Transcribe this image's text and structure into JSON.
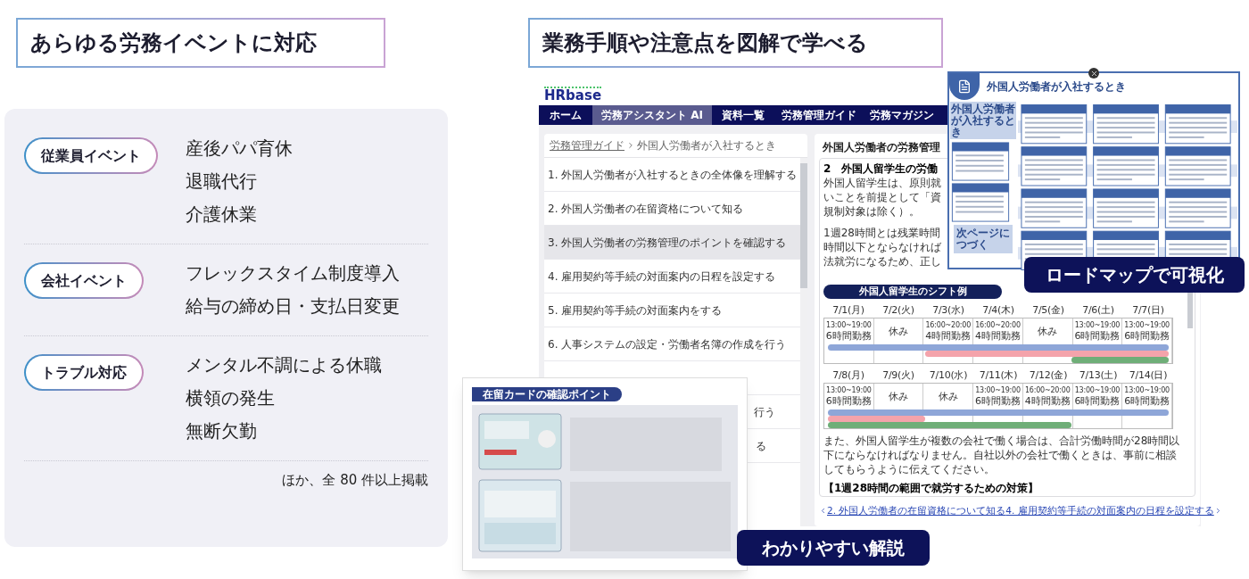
{
  "left_heading": "あらゆる労務イベントに対応",
  "event_groups": [
    {
      "label": "従業員イベント",
      "items": [
        "産後パパ育休",
        "退職代行",
        "介護休業"
      ]
    },
    {
      "label": "会社イベント",
      "items": [
        "フレックスタイム制度導入",
        "給与の締め日・支払日変更"
      ]
    },
    {
      "label": "トラブル対応",
      "items": [
        "メンタル不調による休職",
        "横領の発生",
        "無断欠勤"
      ]
    }
  ],
  "event_note": "ほか、全 80 件以上掲載",
  "right_heading": "業務手順や注意点を図解で学べる",
  "app": {
    "logo": "HRbase",
    "nav": [
      {
        "label": "ホーム",
        "selected": false
      },
      {
        "label": "労務アシスタント AI",
        "selected": true
      },
      {
        "label": "資料一覧",
        "selected": false
      },
      {
        "label": "労務管理ガイド",
        "selected": false
      },
      {
        "label": "労務マガジン",
        "selected": false
      }
    ],
    "breadcrumb": {
      "link": "労務管理ガイド",
      "current": "外国人労働者が入社するとき"
    },
    "steps": [
      {
        "number": "1.",
        "label": "外国人労働者が入社するときの全体像を理解する",
        "selected": false
      },
      {
        "number": "2.",
        "label": "外国人労働者の在留資格について知る",
        "selected": false
      },
      {
        "number": "3.",
        "label": "外国人労働者の労務管理のポイントを確認する",
        "selected": true
      },
      {
        "number": "4.",
        "label": "雇用契約等手続の対面案内の日程を設定する",
        "selected": false
      },
      {
        "number": "5.",
        "label": "雇用契約等手続の対面案内をする",
        "selected": false
      },
      {
        "number": "6.",
        "label": "人事システムの設定・労働者名簿の作成を行う",
        "selected": false
      }
    ],
    "step_fragments": [
      "行う",
      "る"
    ],
    "article": {
      "title": "外国人労働者の労務管理",
      "section": "2　外国人留学生の労働",
      "lines_1": [
        "外国人留学生は、原則就",
        "いことを前提として「資",
        "規制対象は除く）。"
      ],
      "lines_2": [
        "1週28時間とは残業時間",
        "時間以下とならなければ",
        "法就労になるため、正し"
      ],
      "shift_label": "外国人留学生のシフト例",
      "weeks": [
        {
          "days": [
            {
              "date": "7/1(月)",
              "time": "13:00~19:00",
              "hours": "6時間勤務"
            },
            {
              "date": "7/2(火)",
              "hours": "休み"
            },
            {
              "date": "7/3(水)",
              "time": "16:00~20:00",
              "hours": "4時間勤務"
            },
            {
              "date": "7/4(木)",
              "time": "16:00~20:00",
              "hours": "4時間勤務"
            },
            {
              "date": "7/5(金)",
              "hours": "休み"
            },
            {
              "date": "7/6(土)",
              "time": "13:00~19:00",
              "hours": "6時間勤務"
            },
            {
              "date": "7/7(日)",
              "time": "13:00~19:00",
              "hours": "6時間勤務"
            }
          ],
          "bars": [
            {
              "color": "#8ea6d8",
              "covers": [
                true,
                true,
                true,
                true,
                true,
                true,
                true
              ]
            },
            {
              "color": "#f4a3ab",
              "covers": [
                false,
                false,
                true,
                true,
                true,
                true,
                true
              ]
            },
            {
              "color": "#6fae78",
              "covers": [
                false,
                false,
                false,
                false,
                false,
                true,
                true
              ]
            }
          ]
        },
        {
          "days": [
            {
              "date": "7/8(月)",
              "time": "13:00~19:00",
              "hours": "6時間勤務"
            },
            {
              "date": "7/9(火)",
              "hours": "休み"
            },
            {
              "date": "7/10(水)",
              "hours": "休み"
            },
            {
              "date": "7/11(木)",
              "time": "13:00~19:00",
              "hours": "6時間勤務"
            },
            {
              "date": "7/12(金)",
              "time": "16:00~20:00",
              "hours": "4時間勤務"
            },
            {
              "date": "7/13(土)",
              "time": "13:00~19:00",
              "hours": "6時間勤務"
            },
            {
              "date": "7/14(日)",
              "time": "13:00~19:00",
              "hours": "6時間勤務"
            }
          ],
          "bars": [
            {
              "color": "#8ea6d8",
              "covers": [
                true,
                true,
                true,
                true,
                true,
                true,
                true
              ]
            },
            {
              "color": "#f4a3ab",
              "covers": [
                true,
                true,
                false,
                false,
                false,
                false,
                false
              ]
            },
            {
              "color": "#6fae78",
              "covers": [
                true,
                true,
                true,
                true,
                true,
                false,
                false
              ]
            }
          ]
        }
      ],
      "paragraph": "また、外国人留学生が複数の会社で働く場合は、合計労働時間が28時間以下にならなければなりません。自社以外の会社で働くときは、事前に相談してもらうように伝えてください。",
      "subheading": "【1週28時間の範囲で就労するための対策】"
    },
    "prev_link": "2. 外国人労働者の在留資格について知る",
    "next_link": "4. 雇用契約等手続の対面案内の日程を設定する"
  },
  "roadmap": {
    "title": "外国人労働者が入社するとき",
    "start_label": "外国人労働者が入社するとき",
    "continue_label": "次ページにつづく",
    "tag": "ロードマップで可視化"
  },
  "card_guide": {
    "title": "在留カードの確認ポイント",
    "tag": "わかりやすい解説"
  }
}
